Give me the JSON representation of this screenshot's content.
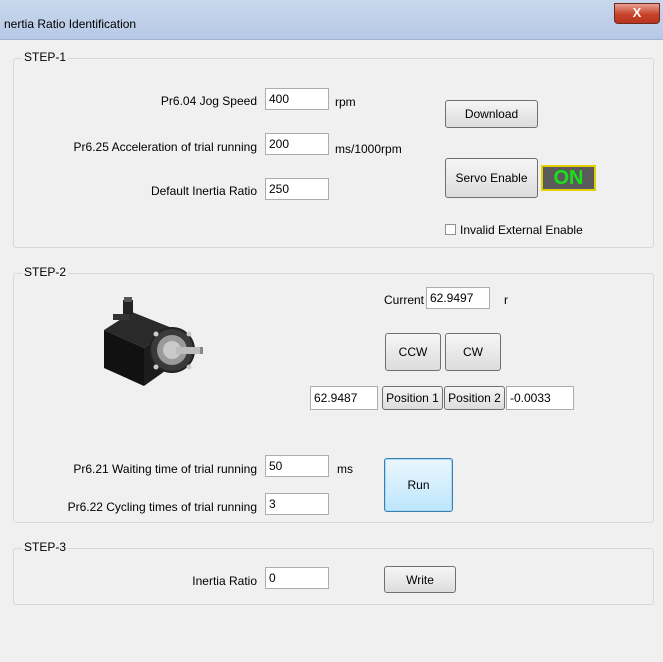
{
  "window": {
    "title": "nertia Ratio Identification",
    "close_symbol": "X"
  },
  "step1": {
    "label": "STEP-1",
    "jog_speed_label": "Pr6.04 Jog Speed",
    "jog_speed_value": "400",
    "jog_speed_unit": "rpm",
    "accel_label": "Pr6.25 Acceleration of trial running",
    "accel_value": "200",
    "accel_unit": "ms/1000rpm",
    "inertia_label": "Default Inertia Ratio",
    "inertia_value": "250",
    "download_button": "Download",
    "servo_enable_button": "Servo Enable",
    "servo_status": "ON",
    "servo_status_color": "#19e019",
    "invalid_external_enable": "Invalid External Enable"
  },
  "step2": {
    "label": "STEP-2",
    "motor_image": "servo-motor-icon",
    "current_label": "Current",
    "current_value": "62.9497",
    "current_unit": "r",
    "ccw_button": "CCW",
    "cw_button": "CW",
    "position1_value": "62.9487",
    "position1_button": "Position 1",
    "position2_button": "Position 2",
    "position2_value": "-0.0033",
    "waiting_label": "Pr6.21 Waiting time of trial running",
    "waiting_value": "50",
    "waiting_unit": "ms",
    "cycling_label": "Pr6.22 Cycling times of trial running",
    "cycling_value": "3",
    "run_button": "Run"
  },
  "step3": {
    "label": "STEP-3",
    "inertia_label": "Inertia Ratio",
    "inertia_value": "0",
    "write_button": "Write"
  }
}
